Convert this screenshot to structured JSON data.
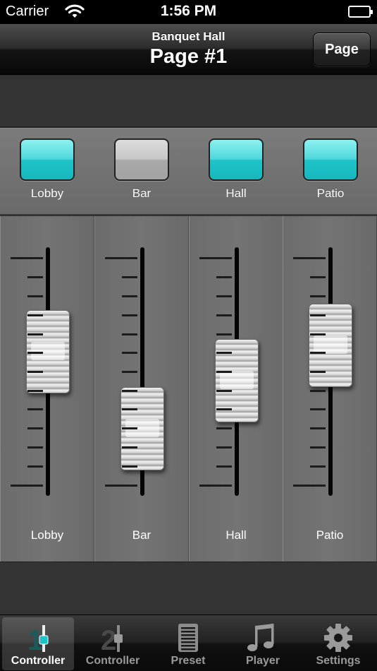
{
  "status_bar": {
    "carrier": "Carrier",
    "time": "1:56 PM"
  },
  "nav": {
    "subtitle": "Banquet Hall",
    "title": "Page #1",
    "page_button": "Page"
  },
  "zones": [
    {
      "label": "Lobby",
      "on": true
    },
    {
      "label": "Bar",
      "on": false
    },
    {
      "label": "Hall",
      "on": true
    },
    {
      "label": "Patio",
      "on": true
    }
  ],
  "faders": [
    {
      "label": "Lobby",
      "level": 0.75
    },
    {
      "label": "Bar",
      "level": 0.35
    },
    {
      "label": "Hall",
      "level": 0.6
    },
    {
      "label": "Patio",
      "level": 0.78
    }
  ],
  "tabs": [
    {
      "label": "Controller",
      "icon": "controller-1-icon",
      "active": true
    },
    {
      "label": "Controller",
      "icon": "controller-2-icon",
      "active": false
    },
    {
      "label": "Preset",
      "icon": "preset-icon",
      "active": false
    },
    {
      "label": "Player",
      "icon": "music-note-icon",
      "active": false
    },
    {
      "label": "Settings",
      "icon": "gear-icon",
      "active": false
    }
  ],
  "colors": {
    "led_on": "#1ec3c8",
    "led_off": "#b8b8b8",
    "tab_active_accent": "#1ec3c8"
  }
}
